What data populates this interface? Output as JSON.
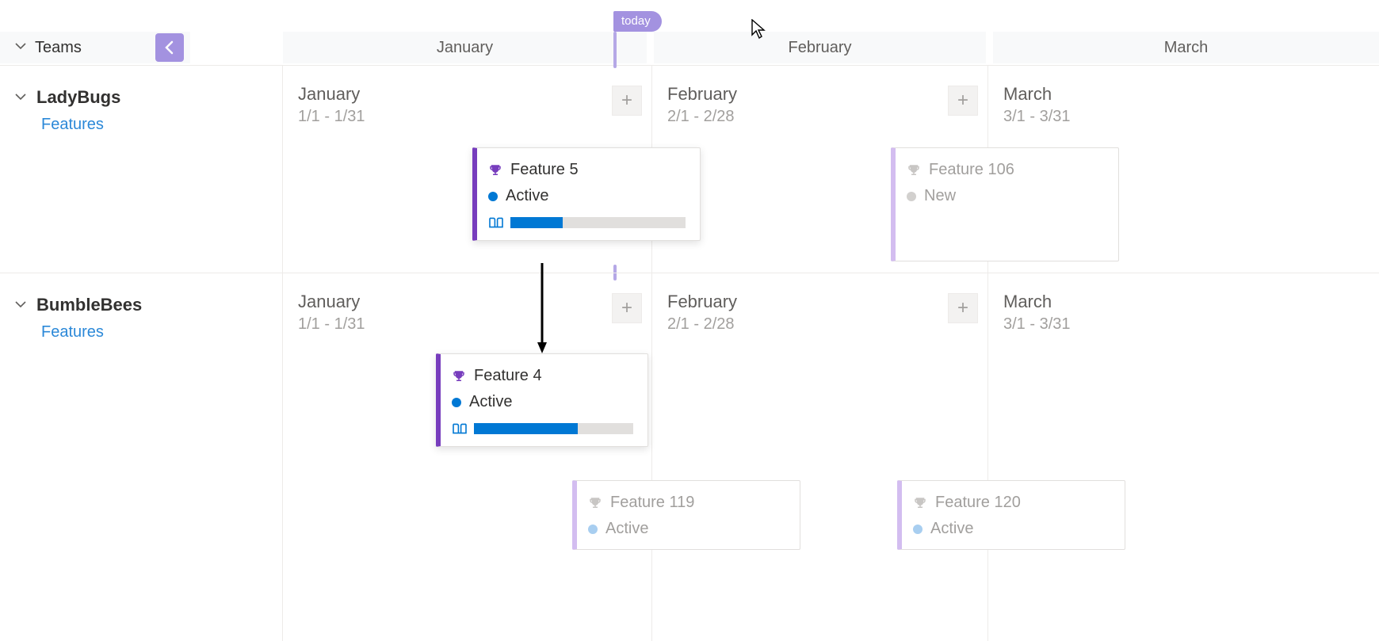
{
  "today_label": "today",
  "header": {
    "label": "Teams"
  },
  "months": [
    "January",
    "February",
    "March"
  ],
  "teams": [
    {
      "name": "LadyBugs",
      "sub": "Features"
    },
    {
      "name": "BumbleBees",
      "sub": "Features"
    }
  ],
  "month_headers": {
    "jan": {
      "name": "January",
      "range": "1/1 - 1/31"
    },
    "feb": {
      "name": "February",
      "range": "2/1 - 2/28"
    },
    "mar": {
      "name": "March",
      "range": "3/1 - 3/31"
    }
  },
  "cards": {
    "f5": {
      "title": "Feature 5",
      "status": "Active",
      "progress": 0.3,
      "accent": "#773dbd",
      "dot": "#0078d4"
    },
    "f106": {
      "title": "Feature 106",
      "status": "New",
      "accent": "#d3bdf0",
      "dot": "#d2d0ce"
    },
    "f4": {
      "title": "Feature 4",
      "status": "Active",
      "progress": 0.65,
      "accent": "#773dbd",
      "dot": "#0078d4"
    },
    "f119": {
      "title": "Feature 119",
      "status": "Active",
      "accent": "#d3bdf0",
      "dot": "#a8cef0"
    },
    "f120": {
      "title": "Feature 120",
      "status": "Active",
      "accent": "#d3bdf0",
      "dot": "#a8cef0"
    }
  }
}
